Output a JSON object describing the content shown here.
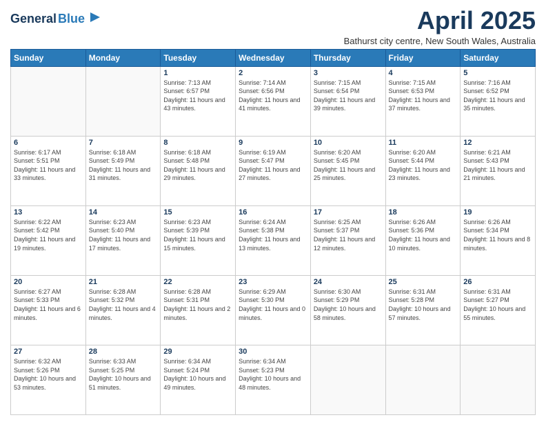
{
  "logo": {
    "line1": "General",
    "line2": "Blue"
  },
  "header": {
    "title": "April 2025",
    "subtitle": "Bathurst city centre, New South Wales, Australia"
  },
  "weekdays": [
    "Sunday",
    "Monday",
    "Tuesday",
    "Wednesday",
    "Thursday",
    "Friday",
    "Saturday"
  ],
  "weeks": [
    [
      {
        "day": "",
        "info": ""
      },
      {
        "day": "",
        "info": ""
      },
      {
        "day": "1",
        "info": "Sunrise: 7:13 AM\nSunset: 6:57 PM\nDaylight: 11 hours and 43 minutes."
      },
      {
        "day": "2",
        "info": "Sunrise: 7:14 AM\nSunset: 6:56 PM\nDaylight: 11 hours and 41 minutes."
      },
      {
        "day": "3",
        "info": "Sunrise: 7:15 AM\nSunset: 6:54 PM\nDaylight: 11 hours and 39 minutes."
      },
      {
        "day": "4",
        "info": "Sunrise: 7:15 AM\nSunset: 6:53 PM\nDaylight: 11 hours and 37 minutes."
      },
      {
        "day": "5",
        "info": "Sunrise: 7:16 AM\nSunset: 6:52 PM\nDaylight: 11 hours and 35 minutes."
      }
    ],
    [
      {
        "day": "6",
        "info": "Sunrise: 6:17 AM\nSunset: 5:51 PM\nDaylight: 11 hours and 33 minutes."
      },
      {
        "day": "7",
        "info": "Sunrise: 6:18 AM\nSunset: 5:49 PM\nDaylight: 11 hours and 31 minutes."
      },
      {
        "day": "8",
        "info": "Sunrise: 6:18 AM\nSunset: 5:48 PM\nDaylight: 11 hours and 29 minutes."
      },
      {
        "day": "9",
        "info": "Sunrise: 6:19 AM\nSunset: 5:47 PM\nDaylight: 11 hours and 27 minutes."
      },
      {
        "day": "10",
        "info": "Sunrise: 6:20 AM\nSunset: 5:45 PM\nDaylight: 11 hours and 25 minutes."
      },
      {
        "day": "11",
        "info": "Sunrise: 6:20 AM\nSunset: 5:44 PM\nDaylight: 11 hours and 23 minutes."
      },
      {
        "day": "12",
        "info": "Sunrise: 6:21 AM\nSunset: 5:43 PM\nDaylight: 11 hours and 21 minutes."
      }
    ],
    [
      {
        "day": "13",
        "info": "Sunrise: 6:22 AM\nSunset: 5:42 PM\nDaylight: 11 hours and 19 minutes."
      },
      {
        "day": "14",
        "info": "Sunrise: 6:23 AM\nSunset: 5:40 PM\nDaylight: 11 hours and 17 minutes."
      },
      {
        "day": "15",
        "info": "Sunrise: 6:23 AM\nSunset: 5:39 PM\nDaylight: 11 hours and 15 minutes."
      },
      {
        "day": "16",
        "info": "Sunrise: 6:24 AM\nSunset: 5:38 PM\nDaylight: 11 hours and 13 minutes."
      },
      {
        "day": "17",
        "info": "Sunrise: 6:25 AM\nSunset: 5:37 PM\nDaylight: 11 hours and 12 minutes."
      },
      {
        "day": "18",
        "info": "Sunrise: 6:26 AM\nSunset: 5:36 PM\nDaylight: 11 hours and 10 minutes."
      },
      {
        "day": "19",
        "info": "Sunrise: 6:26 AM\nSunset: 5:34 PM\nDaylight: 11 hours and 8 minutes."
      }
    ],
    [
      {
        "day": "20",
        "info": "Sunrise: 6:27 AM\nSunset: 5:33 PM\nDaylight: 11 hours and 6 minutes."
      },
      {
        "day": "21",
        "info": "Sunrise: 6:28 AM\nSunset: 5:32 PM\nDaylight: 11 hours and 4 minutes."
      },
      {
        "day": "22",
        "info": "Sunrise: 6:28 AM\nSunset: 5:31 PM\nDaylight: 11 hours and 2 minutes."
      },
      {
        "day": "23",
        "info": "Sunrise: 6:29 AM\nSunset: 5:30 PM\nDaylight: 11 hours and 0 minutes."
      },
      {
        "day": "24",
        "info": "Sunrise: 6:30 AM\nSunset: 5:29 PM\nDaylight: 10 hours and 58 minutes."
      },
      {
        "day": "25",
        "info": "Sunrise: 6:31 AM\nSunset: 5:28 PM\nDaylight: 10 hours and 57 minutes."
      },
      {
        "day": "26",
        "info": "Sunrise: 6:31 AM\nSunset: 5:27 PM\nDaylight: 10 hours and 55 minutes."
      }
    ],
    [
      {
        "day": "27",
        "info": "Sunrise: 6:32 AM\nSunset: 5:26 PM\nDaylight: 10 hours and 53 minutes."
      },
      {
        "day": "28",
        "info": "Sunrise: 6:33 AM\nSunset: 5:25 PM\nDaylight: 10 hours and 51 minutes."
      },
      {
        "day": "29",
        "info": "Sunrise: 6:34 AM\nSunset: 5:24 PM\nDaylight: 10 hours and 49 minutes."
      },
      {
        "day": "30",
        "info": "Sunrise: 6:34 AM\nSunset: 5:23 PM\nDaylight: 10 hours and 48 minutes."
      },
      {
        "day": "",
        "info": ""
      },
      {
        "day": "",
        "info": ""
      },
      {
        "day": "",
        "info": ""
      }
    ]
  ]
}
